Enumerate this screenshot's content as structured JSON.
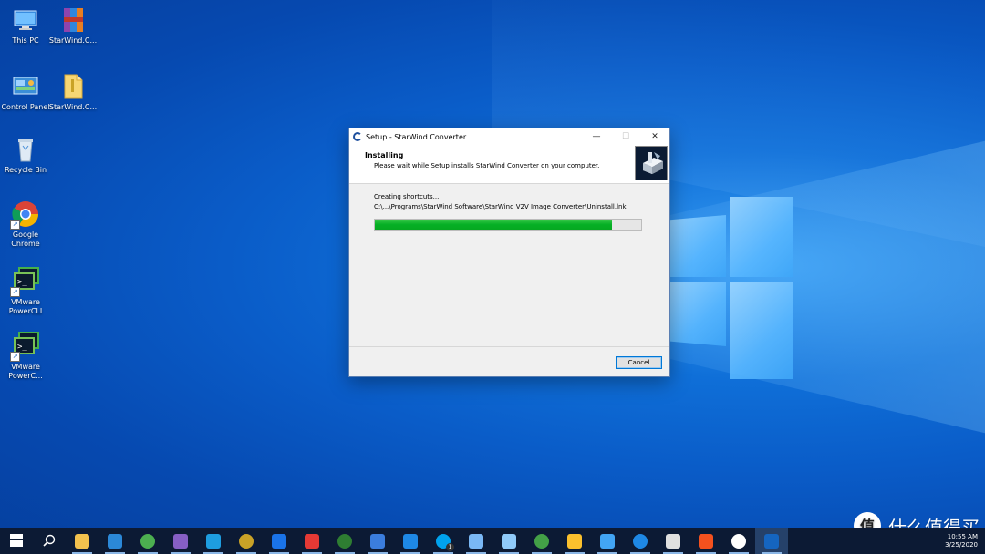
{
  "desktop": {
    "icons": [
      {
        "label": "This PC",
        "icon": "computer-icon"
      },
      {
        "label": "StarWind.C...",
        "icon": "archive-icon"
      },
      {
        "label": "Control Panel",
        "icon": "control-panel-icon"
      },
      {
        "label": "StarWind.C...",
        "icon": "folder-icon"
      },
      {
        "label": "Recycle Bin",
        "icon": "recycle-bin-icon"
      },
      {
        "label": "Google Chrome",
        "icon": "chrome-icon"
      },
      {
        "label": "VMware PowerCLI",
        "icon": "powercli-icon"
      },
      {
        "label": "VMware PowerC...",
        "icon": "powercli-icon"
      }
    ]
  },
  "setup": {
    "window_title": "Setup - StarWind Converter",
    "minimize": "—",
    "maximize": "☐",
    "close": "✕",
    "header_title": "Installing",
    "header_subtitle": "Please wait while Setup installs StarWind Converter on your computer.",
    "status_text": "Creating shortcuts...",
    "current_file": "C:\\...\\Programs\\StarWind Software\\StarWind V2V Image Converter\\Uninstall.lnk",
    "progress_fraction": 0.89,
    "cancel_label": "Cancel"
  },
  "taskbar": {
    "items": [
      {
        "name": "start-button",
        "icon": "windows-icon",
        "color": "#ffffff"
      },
      {
        "name": "search-button",
        "icon": "search-icon",
        "color": "#ffffff"
      },
      {
        "name": "file-explorer",
        "icon": "folder-icon",
        "color": "#f2c14e"
      },
      {
        "name": "mail",
        "icon": "mail-icon",
        "color": "#2b88d8"
      },
      {
        "name": "chrome",
        "icon": "chrome-icon",
        "color": "#4caf50"
      },
      {
        "name": "visual-studio",
        "icon": "visual-studio-icon",
        "color": "#865fc5"
      },
      {
        "name": "vscode",
        "icon": "vscode-icon",
        "color": "#1e9de0"
      },
      {
        "name": "tools",
        "icon": "tools-icon",
        "color": "#c9a227"
      },
      {
        "name": "maps",
        "icon": "location-pin-icon",
        "color": "#1a73e8"
      },
      {
        "name": "photos-app",
        "icon": "grid-app-icon",
        "color": "#e53935"
      },
      {
        "name": "s-app",
        "icon": "s-logo-icon",
        "color": "#2e7d32"
      },
      {
        "name": "editor-app",
        "icon": "pen-icon",
        "color": "#3b7ddd"
      },
      {
        "name": "star-app",
        "icon": "star-icon",
        "color": "#1e88e5"
      },
      {
        "name": "skype",
        "icon": "skype-icon",
        "color": "#00a2ed",
        "badge": "1"
      },
      {
        "name": "feather-app",
        "icon": "feather-icon",
        "color": "#7ab8f5"
      },
      {
        "name": "remote-desktop",
        "icon": "monitor-icon",
        "color": "#90caf9"
      },
      {
        "name": "wechat",
        "icon": "wechat-icon",
        "color": "#43a047"
      },
      {
        "name": "yellow-app",
        "icon": "circle-app-icon",
        "color": "#fbc02d"
      },
      {
        "name": "cloud-app",
        "icon": "cloud-icon",
        "color": "#42a5f5"
      },
      {
        "name": "globe-app",
        "icon": "globe-icon",
        "color": "#1e88e5"
      },
      {
        "name": "monitor-app",
        "icon": "screen-icon",
        "color": "#e0e0e0"
      },
      {
        "name": "swift-app",
        "icon": "swift-icon",
        "color": "#f4511e"
      },
      {
        "name": "slack",
        "icon": "slack-icon",
        "color": "#ffffff"
      },
      {
        "name": "starwind-setup",
        "icon": "starwind-icon",
        "color": "#1565c0"
      }
    ],
    "clock_time": "10:55 AM",
    "clock_date": "3/25/2020"
  },
  "watermark": {
    "text": "什么值得买",
    "icon": "zhi-icon"
  }
}
